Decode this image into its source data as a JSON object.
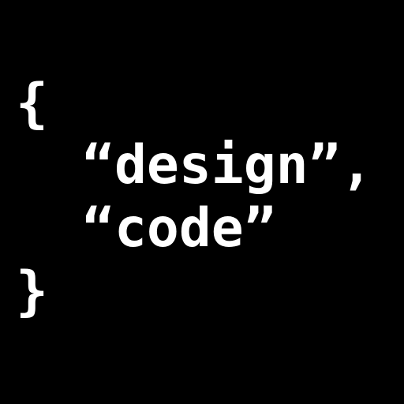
{
  "lines": {
    "open_brace": "{",
    "design_entry": "“design”,",
    "code_entry": "“code”",
    "close_brace": "}"
  },
  "colors": {
    "background": "#000000",
    "text": "#ffffff"
  }
}
